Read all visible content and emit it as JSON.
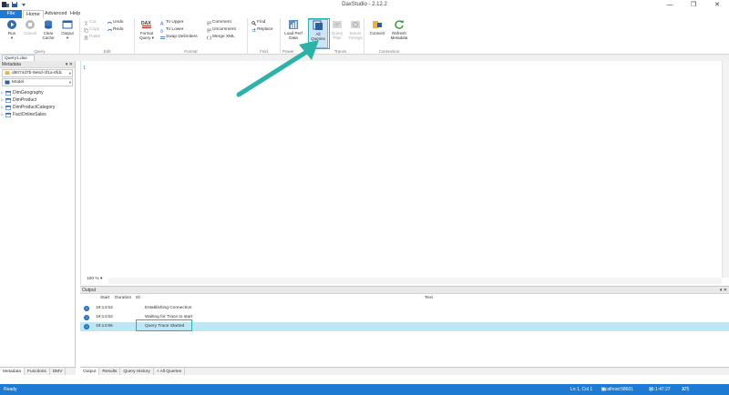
{
  "window": {
    "title": "DaxStudio - 2.12.2",
    "controls": [
      "—",
      "❐",
      "✕"
    ]
  },
  "menu": {
    "tabs": [
      "File",
      "Home",
      "Advanced",
      "Help"
    ]
  },
  "ribbon": {
    "query_group": {
      "label": "Query",
      "run": "Run",
      "cancel": "Cancel",
      "clear_cache": [
        "Clear",
        "Cache"
      ],
      "output": "Output"
    },
    "edit_group": {
      "label": "Edit",
      "cut": "Cut",
      "copy": "Copy",
      "paste": "Paste",
      "undo": "Undo",
      "redo": "Redo"
    },
    "format_group": {
      "label": "Format",
      "format_query": [
        "Format",
        "Query ▾"
      ],
      "to_upper": "To Upper",
      "to_lower": "To Lower",
      "swap_delimiters": "Swap Delimiters",
      "comment": "Comment",
      "uncomment": "Uncomment",
      "merge_xml": "Merge XML"
    },
    "find_group": {
      "label": "Find",
      "find": "Find",
      "replace": "Replace"
    },
    "traces_group": {
      "label": "Traces",
      "power_label": "Power",
      "load_perf_data": [
        "Load Perf",
        "Data"
      ],
      "all_queries": [
        "All",
        "Queries"
      ],
      "query_plan": [
        "Query",
        "Plan"
      ],
      "server_timings": [
        "Server",
        "Timings"
      ]
    },
    "connection_group": {
      "label": "Connection",
      "connect": "Connect",
      "refresh_metadata": [
        "Refresh",
        "Metadata"
      ]
    }
  },
  "doc_tab": {
    "label": "Query1.dax",
    "close": "✕"
  },
  "metadata_pane": {
    "title": "Metadata",
    "database": "d8074d7b-9e6d-4f1a-8fdc",
    "model": "Model",
    "tables": [
      "DimGeography",
      "DimProduct",
      "DimProductCategory",
      "FactOnlineSales"
    ],
    "bottom_tabs": [
      "Metadata",
      "Functions",
      "DMV"
    ]
  },
  "editor": {
    "line_number": "1",
    "zoom": "100 %"
  },
  "output_pane": {
    "title": "Output",
    "columns": {
      "start": "Start",
      "duration": "Duration",
      "id": "ID",
      "text": "Text"
    },
    "rows": [
      {
        "start": "19:14:53",
        "text": "Establishing Connection"
      },
      {
        "start": "19:14:53",
        "text": "Waiting for Trace to start"
      },
      {
        "start": "19:14:56",
        "text": "Query Trace Started"
      }
    ],
    "bottom_tabs": [
      "Output",
      "Results",
      "Query History",
      "All Queries"
    ]
  },
  "status_bar": {
    "ready": "Ready",
    "position": "Ln 1, Col 1",
    "server": "localhost:58601",
    "elapsed": "15:1:47:27",
    "spid": "275"
  },
  "colors": {
    "accent": "#1d7bd4",
    "annotation": "#2bb2a9",
    "selected_row": "#bfe6f5"
  }
}
